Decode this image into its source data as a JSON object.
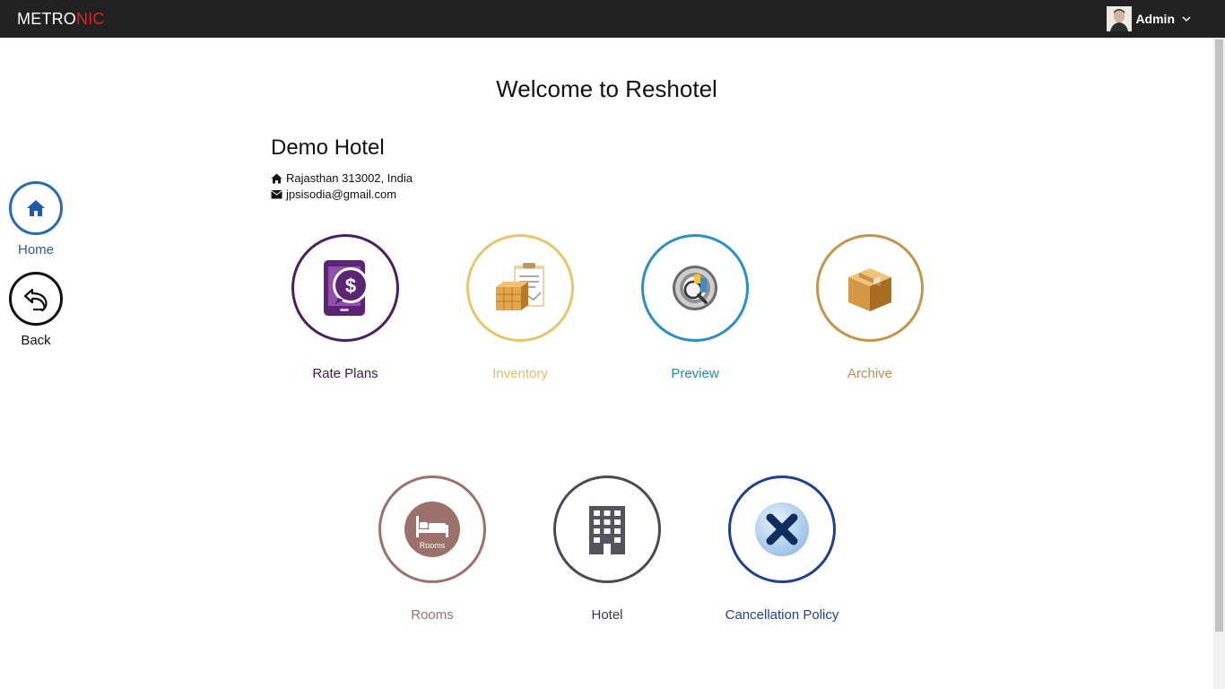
{
  "brand": {
    "part1": "METRO",
    "part2": "NIC"
  },
  "header": {
    "user_name": "Admin"
  },
  "page": {
    "welcome": "Welcome to Reshotel"
  },
  "hotel": {
    "name": "Demo Hotel",
    "address": "Rajasthan 313002, India",
    "email": "jpsisodia@gmail.com"
  },
  "side_nav": {
    "home_label": "Home",
    "back_label": "Back"
  },
  "tiles": [
    {
      "label": "Rate Plans",
      "color": "#4a1f5e",
      "icon": "rate-plans-icon"
    },
    {
      "label": "Inventory",
      "color": "#e6c56b",
      "icon": "inventory-icon"
    },
    {
      "label": "Preview",
      "color": "#2b8fc7",
      "icon": "preview-icon"
    },
    {
      "label": "Archive",
      "color": "#c39449",
      "icon": "archive-box-icon"
    },
    {
      "label": "Rooms",
      "color": "#9c716b",
      "icon": "rooms-bed-icon",
      "icon_text": "Rooms"
    },
    {
      "label": "Hotel",
      "color": "#4a4955",
      "icon": "hotel-building-icon"
    },
    {
      "label": "Cancellation Policy",
      "color": "#1f3f94",
      "icon": "cancel-x-icon"
    }
  ]
}
